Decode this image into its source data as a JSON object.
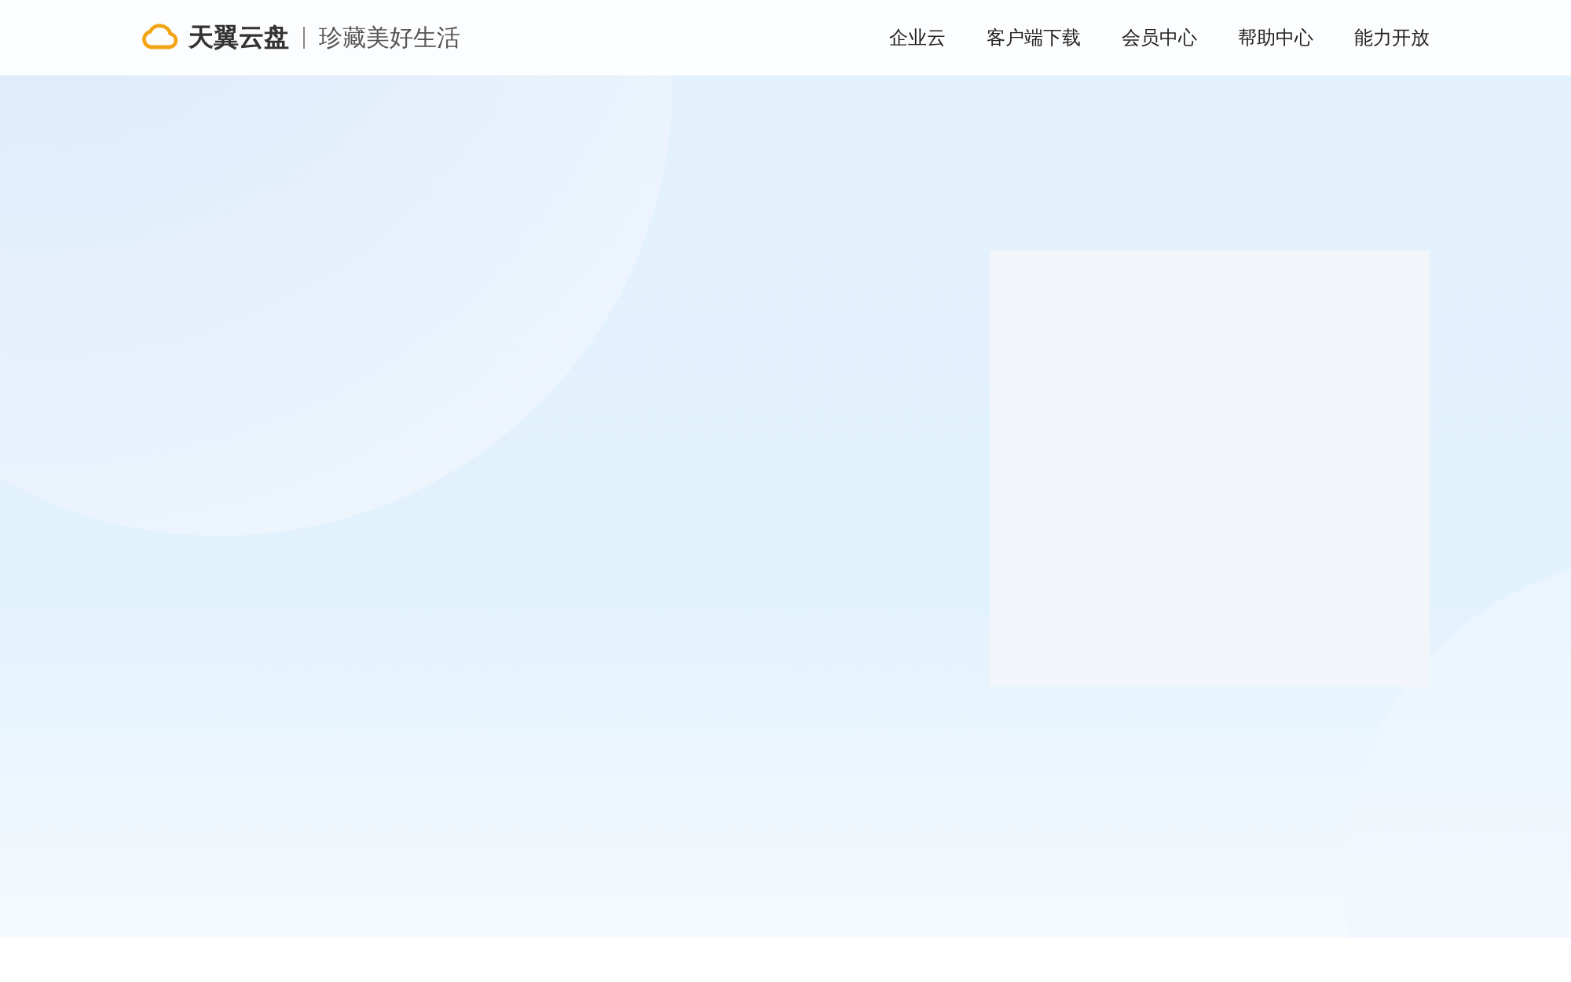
{
  "header": {
    "logo_text": "天翼云盘",
    "tagline": "珍藏美好生活",
    "nav": [
      {
        "label": "企业云"
      },
      {
        "label": "客户端下载"
      },
      {
        "label": "会员中心"
      },
      {
        "label": "帮助中心"
      },
      {
        "label": "能力开放"
      }
    ]
  }
}
